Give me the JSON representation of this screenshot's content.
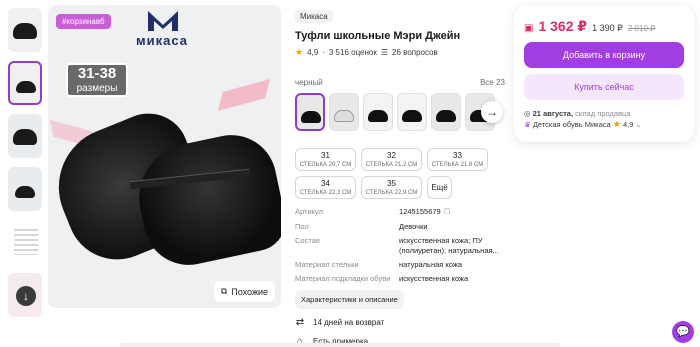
{
  "gallery": {
    "tag": "#корзинавб",
    "brand_logo_text": "микаса",
    "size_range": "31-38",
    "size_word": "размеры",
    "similar_label": "Похожие",
    "download_icon": "arrow-down-icon"
  },
  "product": {
    "brand": "Микаса",
    "title": "Туфли школьные Мэри Джейн",
    "rating": "4,9",
    "reviews": "3 516 оценок",
    "questions": "26 вопросов"
  },
  "colors": {
    "selected": "черный",
    "all_link": "Все 23",
    "count_visible": 6
  },
  "sizes": [
    {
      "size": "31",
      "insole": "СТЕЛЬКА 20,7 СМ"
    },
    {
      "size": "32",
      "insole": "СТЕЛЬКА 21,2 СМ"
    },
    {
      "size": "33",
      "insole": "СТЕЛЬКА 21,6 СМ"
    },
    {
      "size": "34",
      "insole": "СТЕЛЬКА 22,3 СМ"
    },
    {
      "size": "35",
      "insole": "СТЕЛЬКА 22,9 СМ"
    }
  ],
  "sizes_more": "Ещё",
  "specs": [
    {
      "k": "Артикул",
      "v": "1245155679"
    },
    {
      "k": "Пол",
      "v": "Девочки"
    },
    {
      "k": "Состав",
      "v": "искусственная кожа; ПУ (полиуретан); натуральная..."
    },
    {
      "k": "Материал стельки",
      "v": "натуральная кожа"
    },
    {
      "k": "Материал подкладки обуви",
      "v": "искусственная кожа"
    }
  ],
  "chars_button": "Характеристики и описание",
  "features": [
    {
      "icon": "return-icon",
      "label": "14 дней на возврат"
    },
    {
      "icon": "hanger-icon",
      "label": "Есть примерка"
    }
  ],
  "buy": {
    "price": "1 362 ₽",
    "price_alt": "1 390 ₽",
    "price_old": "2 010 ₽",
    "cart_label": "Добавить в корзину",
    "buy_now_label": "Купить сейчас",
    "delivery_date": "21 августа,",
    "delivery_from": "склад продавца",
    "seller": "Детская обувь Микаса",
    "seller_rating": "4,9"
  },
  "colors_theme": {
    "accent": "#a23ce3",
    "price": "#e02b63",
    "tag": "#c75fd9"
  }
}
